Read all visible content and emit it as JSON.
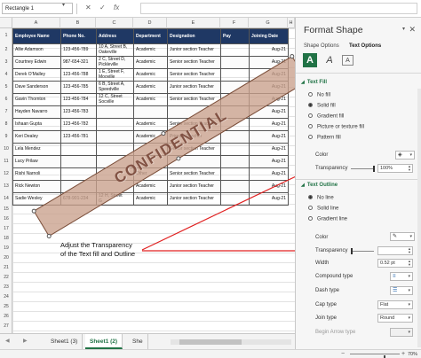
{
  "name_box": "Rectangle 1",
  "formula_bar": {
    "cancel": "✕",
    "confirm": "✓",
    "fx": "fx",
    "value": ""
  },
  "columns": [
    "A",
    "B",
    "C",
    "D",
    "E",
    "F",
    "G",
    "H"
  ],
  "rows": [
    "1",
    "2",
    "3",
    "4",
    "5",
    "6",
    "7",
    "8",
    "9",
    "10",
    "11",
    "12",
    "13",
    "14",
    "15",
    "16",
    "17",
    "18",
    "19",
    "20",
    "21",
    "22",
    "23",
    "24",
    "25",
    "26",
    "27",
    "28"
  ],
  "table": {
    "headers": [
      "Employee Name",
      "Phone No.",
      "Address",
      "Department",
      "Designation",
      "Pay",
      "Joining Date"
    ],
    "rows": [
      [
        "Allie Adamson",
        "123-456-789",
        "10 A, Street B,\nOakeville",
        "Academic",
        "Junior section Teacher",
        "",
        "Aug-21"
      ],
      [
        "Courtney Edwin",
        "987-654-321",
        "2 C, Street D,\nPickleville",
        "Academic",
        "Senior section Teacher",
        "",
        "Aug-21"
      ],
      [
        "Derek O'Malley",
        "123-456-788",
        "1 E, Street F,\nMooville",
        "Academic",
        "Senior section Teacher",
        "",
        "Aug-21"
      ],
      [
        "Dave Sanderson",
        "123-456-785",
        "6 B, Street A,\nSpeedville",
        "Academic",
        "Junior section Teacher",
        "",
        "Aug-21"
      ],
      [
        "Gavin Thornton",
        "123-456-784",
        "12 C, Street\nSocville",
        "Academic",
        "Senior section Teacher",
        "",
        "Aug-21"
      ],
      [
        "Hayden Navarro",
        "123-456-783",
        "",
        "",
        "",
        "",
        "Aug-21"
      ],
      [
        "Ishaan Gupta",
        "123-456-782",
        "",
        "Academic",
        "Senior section Teacher",
        "",
        "Aug-21"
      ],
      [
        "Keri Dealey",
        "123-456-781",
        "",
        "Academic",
        "Primary Teacher",
        "",
        "Aug-21"
      ],
      [
        "Lela Mendez",
        "",
        "",
        "",
        "Senior section Teacher",
        "",
        "Aug-21"
      ],
      [
        "Lucy Prilaw",
        "",
        "",
        "",
        "",
        "",
        "Aug-21"
      ],
      [
        "Rishi Narnoli",
        "",
        "",
        "Other",
        "Senior section Teacher",
        "",
        "Aug-21"
      ],
      [
        "Rick Newton",
        "",
        "",
        "Academic",
        "Junior section Teacher",
        "",
        "Aug-21"
      ],
      [
        "Sadie Wesley",
        "678-901-234",
        "12 H, Street\nG",
        "Academic",
        "Junior section Teacher",
        "",
        "Aug-21"
      ]
    ]
  },
  "watermark_text": "CONFIDENTIAL",
  "callout": {
    "line1": "Adjust the Transparency",
    "line2": "of the Text fill and Outline"
  },
  "sheet_tabs": [
    {
      "label": "Sheet1 (3)",
      "active": false
    },
    {
      "label": "Sheet1 (2)",
      "active": true
    },
    {
      "label": "She",
      "active": false
    }
  ],
  "zoom": {
    "label": "70%",
    "fraction": 0.7
  },
  "pane": {
    "title": "Format Shape",
    "tabs": [
      "Shape Options",
      "Text Options"
    ],
    "active_tab": "Text Options",
    "icons": [
      "text-fill-outline-icon",
      "text-effects-icon",
      "textbox-icon"
    ],
    "text_fill": {
      "heading": "Text Fill",
      "options": [
        "No fill",
        "Solid fill",
        "Gradient fill",
        "Picture or texture fill",
        "Pattern fill"
      ],
      "selected": "Solid fill",
      "color_label": "Color",
      "transparency_label": "Transparency",
      "transparency_value": "100%",
      "transparency_fraction": 1.0
    },
    "text_outline": {
      "heading": "Text Outline",
      "options": [
        "No line",
        "Solid line",
        "Gradient line"
      ],
      "selected": "No line",
      "color_label": "Color",
      "transparency_label": "Transparency",
      "transparency_fraction": 0.0,
      "width_label": "Width",
      "width_value": "0.52 pt",
      "compound_label": "Compound type",
      "dash_label": "Dash type",
      "cap_label": "Cap type",
      "cap_value": "Flat",
      "join_label": "Join type",
      "join_value": "Round",
      "arrow_label": "Begin Arrow type"
    }
  },
  "colors": {
    "header_bg": "#1f3864",
    "accent_green": "#217346",
    "arrow_red": "#e02020"
  }
}
